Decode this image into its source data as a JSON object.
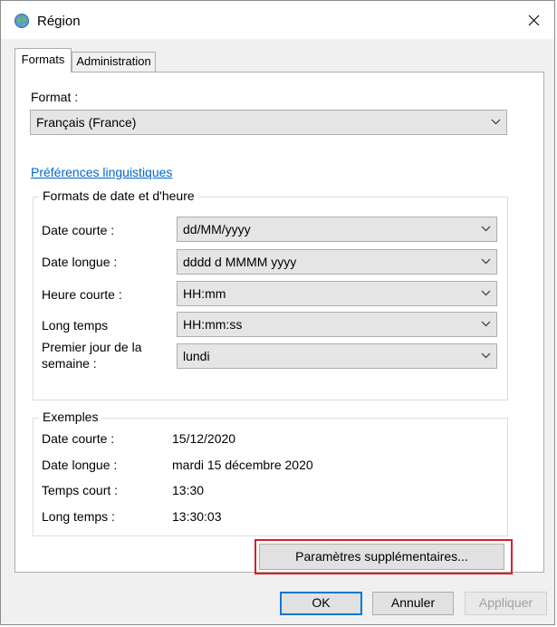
{
  "window": {
    "title": "Région",
    "icon": "globe-icon"
  },
  "tabs": [
    {
      "label": "Formats",
      "active": true
    },
    {
      "label": "Administration",
      "active": false
    }
  ],
  "format": {
    "label": "Format :",
    "value": "Français (France)"
  },
  "language_link": "Préférences linguistiques",
  "date_time_group": {
    "title": "Formats de date et d'heure",
    "rows": [
      {
        "label": "Date courte :",
        "value": "dd/MM/yyyy"
      },
      {
        "label": "Date longue :",
        "value": "dddd d MMMM yyyy"
      },
      {
        "label": "Heure courte :",
        "value": "HH:mm"
      },
      {
        "label": "Long temps",
        "value": "HH:mm:ss"
      },
      {
        "label_line1": "Premier jour de la",
        "label_line2": "semaine :",
        "value": "lundi"
      }
    ]
  },
  "examples_group": {
    "title": "Exemples",
    "rows": [
      {
        "label": "Date courte :",
        "value": "15/12/2020"
      },
      {
        "label": "Date longue :",
        "value": "mardi 15 décembre 2020"
      },
      {
        "label": "Temps court :",
        "value": "13:30"
      },
      {
        "label": "Long temps :",
        "value": "13:30:03"
      }
    ]
  },
  "buttons": {
    "extra": "Paramètres supplémentaires...",
    "ok": "OK",
    "cancel": "Annuler",
    "apply": "Appliquer"
  },
  "colors": {
    "link": "#0066cc",
    "highlight": "#d91f26",
    "default_button_border": "#0078d7"
  }
}
